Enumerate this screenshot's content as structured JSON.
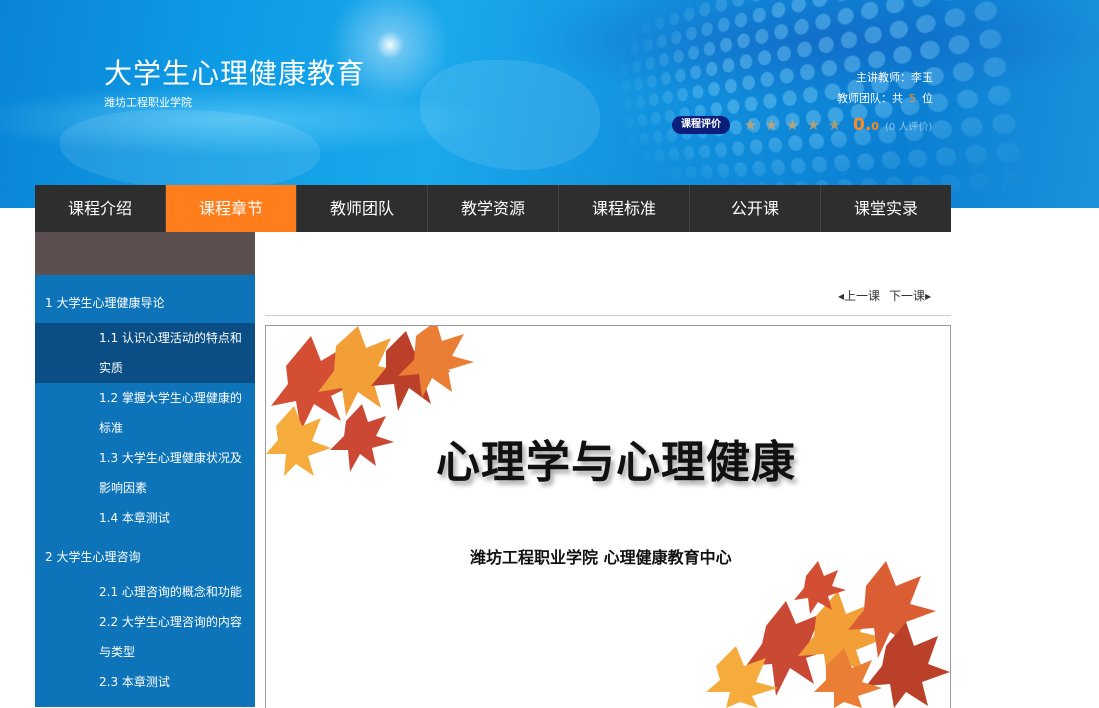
{
  "header": {
    "title": "大学生心理健康教育",
    "school": "潍坊工程职业学院",
    "teacher_label": "主讲教师：",
    "teacher_name": "李玉",
    "team_label": "教师团队：共",
    "team_count": "5",
    "team_unit": "位",
    "rate_button": "课程评价",
    "score_main": "0.",
    "score_decimal": "0",
    "rate_count": "(0 人评价)"
  },
  "nav": {
    "items": [
      "课程介绍",
      "课程章节",
      "教师团队",
      "教学资源",
      "课程标准",
      "公开课",
      "课堂实录"
    ],
    "active_index": 1
  },
  "sidebar": {
    "chapters": [
      {
        "title": "1 大学生心理健康导论",
        "lessons": [
          "1.1 认识心理活动的特点和实质",
          "1.2 掌握大学生心理健康的标准",
          "1.3 大学生心理健康状况及影响因素",
          "1.4 本章测试"
        ]
      },
      {
        "title": "2 大学生心理咨询",
        "lessons": [
          "2.1 心理咨询的概念和功能",
          "2.2 大学生心理咨询的内容与类型",
          "2.3 本章测试"
        ]
      }
    ],
    "active_lesson": "1.1 认识心理活动的特点和实质"
  },
  "pager": {
    "prev": "上一课",
    "next": "下一课"
  },
  "slide": {
    "title": "心理学与心理健康",
    "subtitle": "潍坊工程职业学院  心理健康教育中心"
  },
  "colors": {
    "nav_active": "#ff7d1a",
    "nav_bg": "#2e2e2e",
    "sidebar_bg": "#0e74b9",
    "sidebar_active": "#0a4e85",
    "banner_blue": "#0e9de6"
  }
}
